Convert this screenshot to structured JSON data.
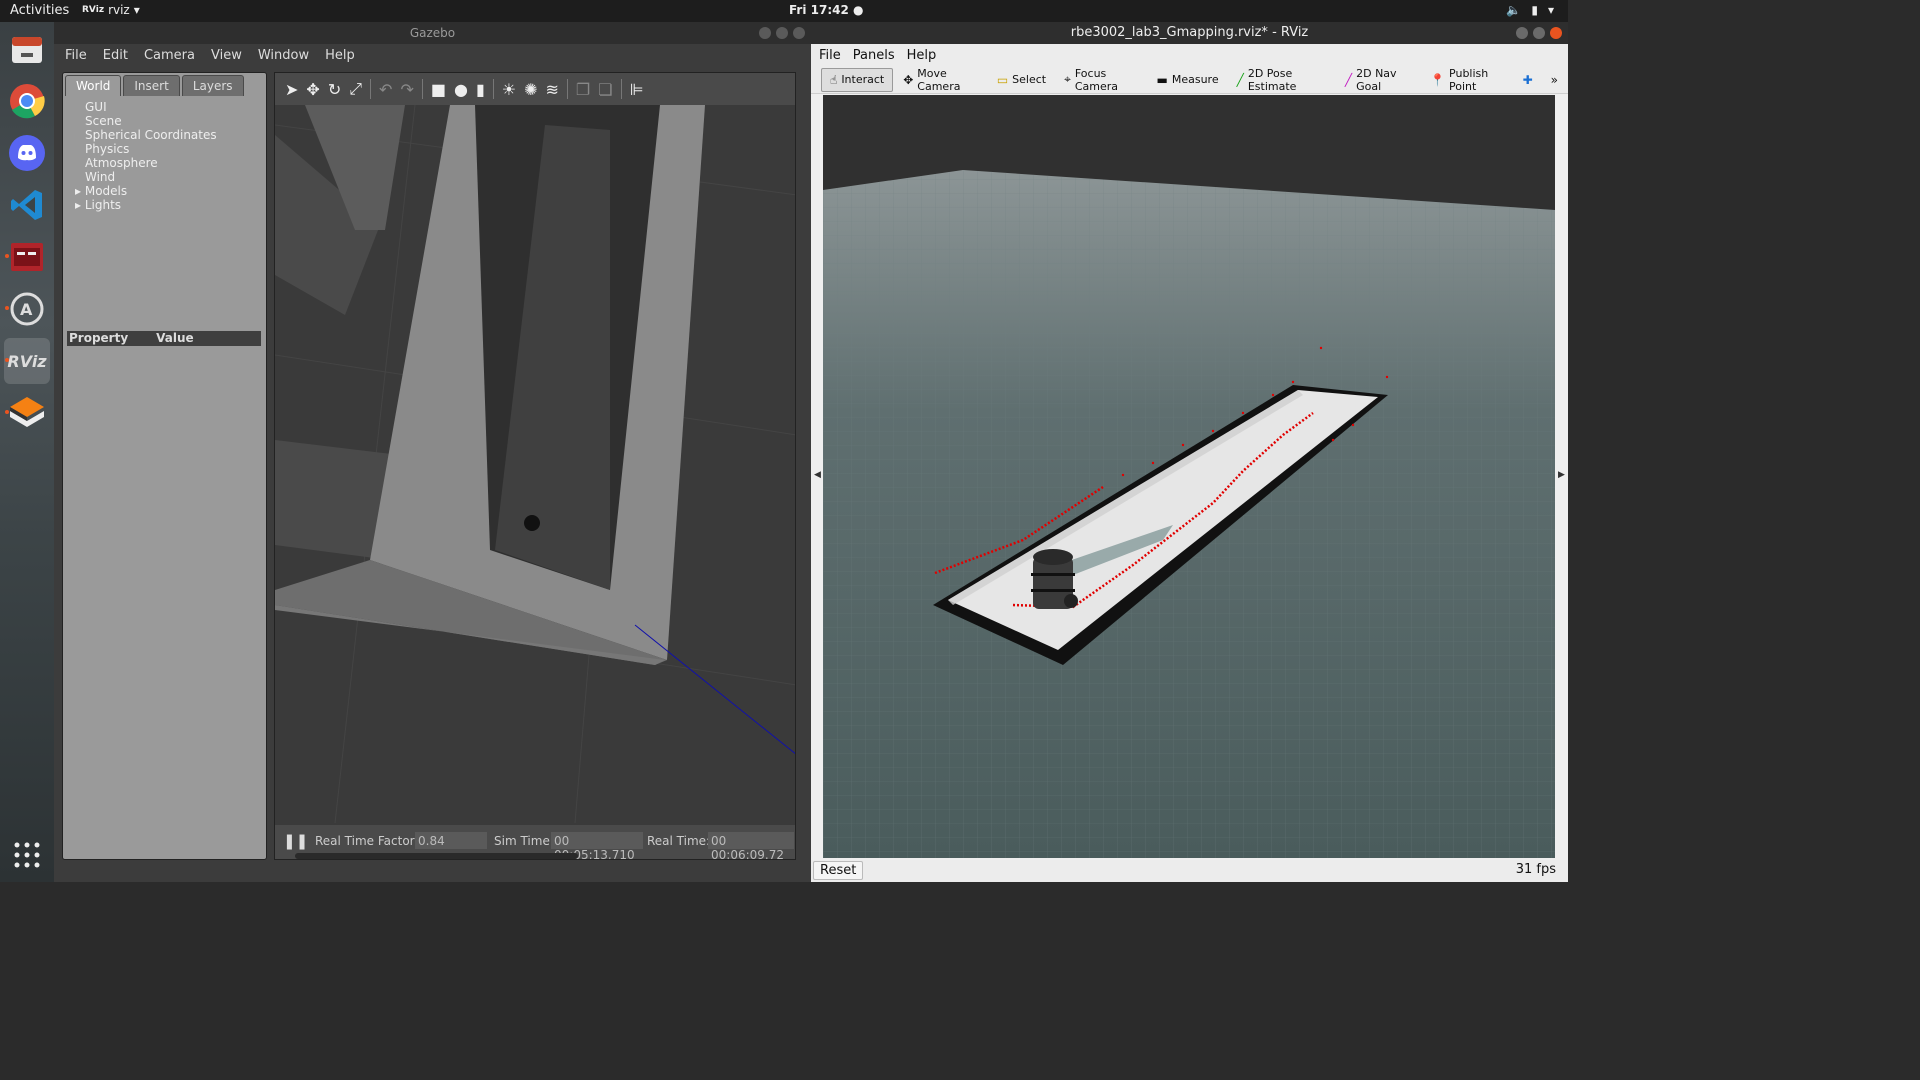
{
  "topbar": {
    "activities": "Activities",
    "app_badge": "RViz",
    "app_name": "rviz",
    "clock": "Fri 17:42 ●"
  },
  "dock": {
    "items": [
      "files-icon",
      "chrome-icon",
      "discord-icon",
      "vscode-icon",
      "terminal-app-icon",
      "software-updater-icon",
      "rviz-icon",
      "gazebo-icon",
      "show-apps-icon"
    ],
    "rviz_label": "RViz"
  },
  "gazebo": {
    "title": "Gazebo",
    "menu": [
      "File",
      "Edit",
      "Camera",
      "View",
      "Window",
      "Help"
    ],
    "tabs": [
      "World",
      "Insert",
      "Layers"
    ],
    "tree": [
      "GUI",
      "Scene",
      "Spherical Coordinates",
      "Physics",
      "Atmosphere",
      "Wind"
    ],
    "tree_expandable": [
      "Models",
      "Lights"
    ],
    "prop_header": {
      "property": "Property",
      "value": "Value"
    },
    "status": {
      "rtf_label": "Real Time Factor:",
      "rtf_value": "0.84",
      "sim_label": "Sim Time:",
      "sim_value": "00 00:05:13.710",
      "real_label": "Real Time:",
      "real_value": "00 00:06:09.72"
    }
  },
  "rviz": {
    "title": "rbe3002_lab3_Gmapping.rviz* - RViz",
    "menu": [
      "File",
      "Panels",
      "Help"
    ],
    "tools": [
      "Interact",
      "Move Camera",
      "Select",
      "Focus Camera",
      "Measure",
      "2D Pose Estimate",
      "2D Nav Goal",
      "Publish Point"
    ],
    "reset": "Reset",
    "fps": "31 fps"
  }
}
